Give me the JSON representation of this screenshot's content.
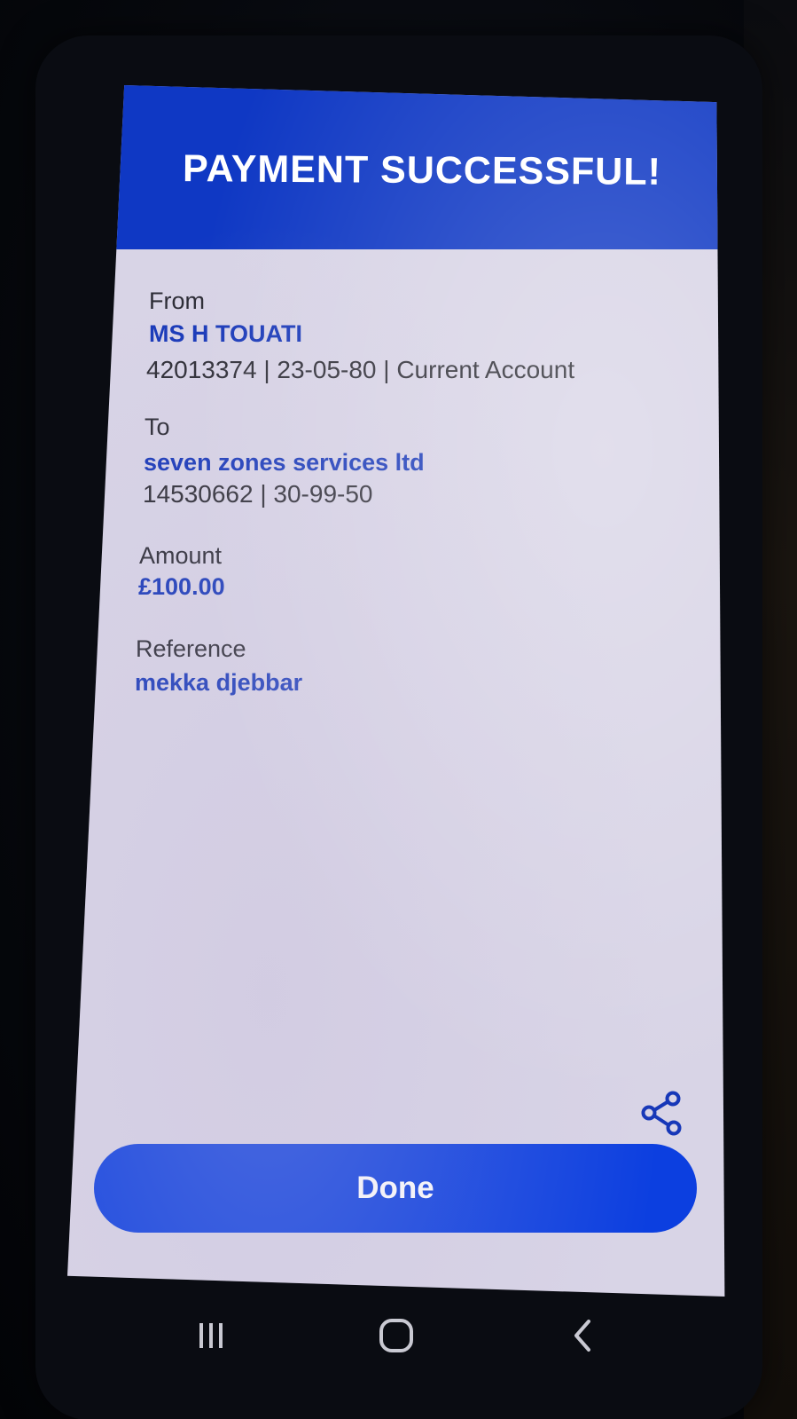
{
  "header": {
    "title": "PAYMENT SUCCESSFUL!"
  },
  "from": {
    "label": "From",
    "name": "MS H TOUATI",
    "details": "42013374 | 23-05-80 | Current Account"
  },
  "to": {
    "label": "To",
    "name": "seven zones services ltd",
    "details": "14530662 | 30-99-50"
  },
  "amount": {
    "label": "Amount",
    "value": "£100.00"
  },
  "reference": {
    "label": "Reference",
    "value": "mekka djebbar"
  },
  "actions": {
    "share_icon": "share-icon",
    "done_label": "Done"
  },
  "system_nav": {
    "recents_icon": "recents-icon",
    "home_icon": "home-icon",
    "back_icon": "back-icon"
  },
  "colors": {
    "brand_blue": "#0f38c4",
    "button_blue": "#0c3fe0",
    "value_blue": "#1637b8"
  }
}
